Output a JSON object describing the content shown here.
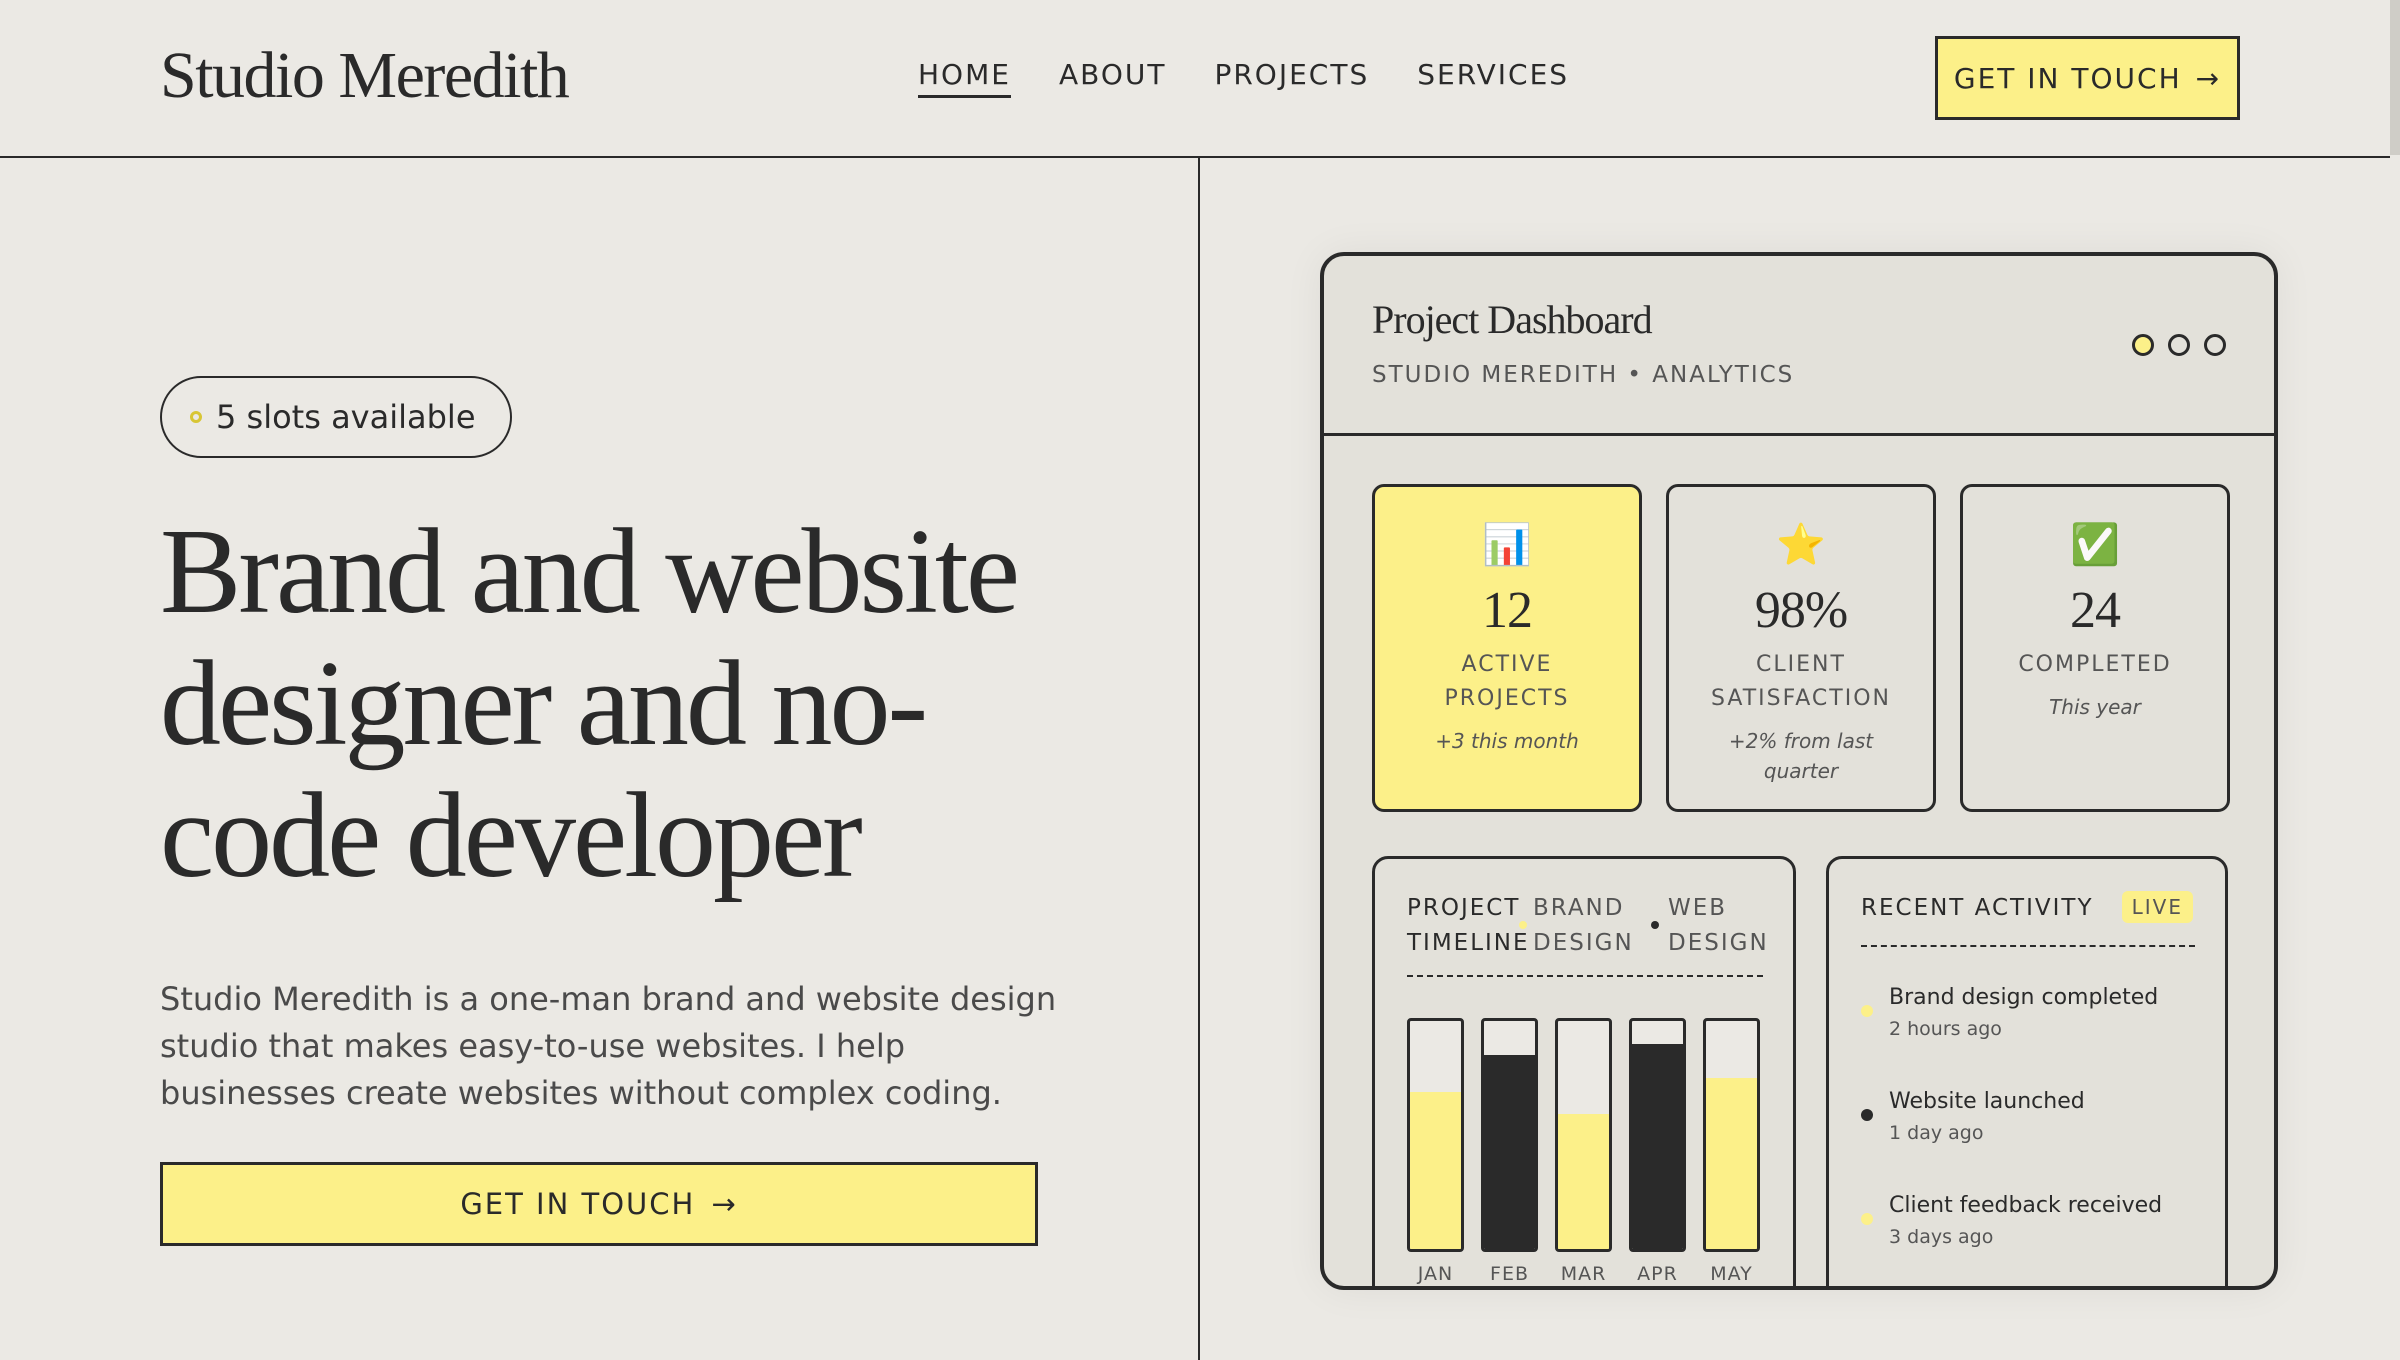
{
  "header": {
    "logo": "Studio Meredith",
    "nav": [
      {
        "label": "HOME",
        "active": true
      },
      {
        "label": "ABOUT",
        "active": false
      },
      {
        "label": "PROJECTS",
        "active": false
      },
      {
        "label": "SERVICES",
        "active": false
      }
    ],
    "cta_label": "GET IN TOUCH",
    "cta_arrow": "→"
  },
  "hero": {
    "badge": "5 slots available",
    "title": "Brand and website designer and no-code developer",
    "description": "Studio Meredith is a one-man brand and website design studio that makes easy-to-use websites. I help businesses create websites without complex coding.",
    "cta_label": "GET IN TOUCH",
    "cta_arrow": "→"
  },
  "dashboard": {
    "title": "Project Dashboard",
    "subtitle": "STUDIO MEREDITH • ANALYTICS",
    "stats": [
      {
        "icon": "📊",
        "icon_name": "bar-chart-icon",
        "value": "12",
        "label": "ACTIVE PROJECTS",
        "note": "+3 this month"
      },
      {
        "icon": "⭐",
        "icon_name": "star-icon",
        "value": "98%",
        "label": "CLIENT SATISFACTION",
        "note": "+2% from last quarter"
      },
      {
        "icon": "✅",
        "icon_name": "check-icon",
        "value": "24",
        "label": "COMPLETED",
        "note": "This year"
      }
    ],
    "timeline": {
      "title": "PROJECT TIMELINE",
      "legend": [
        {
          "label": "BRAND DESIGN",
          "color": "#fcf089"
        },
        {
          "label": "WEB DESIGN",
          "color": "#2a2a2a"
        }
      ]
    },
    "activity": {
      "title": "RECENT ACTIVITY",
      "live_label": "LIVE",
      "items": [
        {
          "text": "Brand design completed",
          "time": "2 hours ago",
          "color": "#fcf089"
        },
        {
          "text": "Website launched",
          "time": "1 day ago",
          "color": "#2a2a2a"
        },
        {
          "text": "Client feedback received",
          "time": "3 days ago",
          "color": "#fcf089"
        }
      ]
    }
  },
  "chart_data": {
    "type": "bar",
    "categories": [
      "JAN",
      "FEB",
      "MAR",
      "APR",
      "MAY"
    ],
    "values": [
      0.69,
      0.85,
      0.59,
      0.9,
      0.75
    ],
    "colors": [
      "#fcf089",
      "#2a2a2a",
      "#fcf089",
      "#2a2a2a",
      "#fcf089"
    ],
    "ylim": [
      0,
      1
    ]
  },
  "colors": {
    "background": "#ebe9e4",
    "accent": "#fcf089",
    "ink": "#2a2a2a"
  }
}
